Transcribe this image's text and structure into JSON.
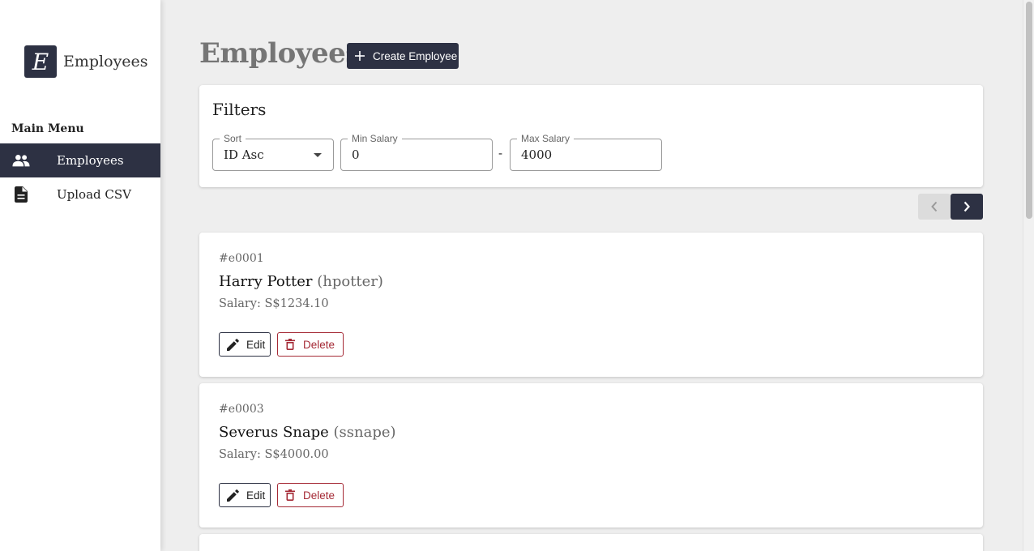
{
  "sidebar": {
    "brand_letter": "E",
    "brand_name": "Employees",
    "menu_heading": "Main Menu",
    "items": [
      {
        "label": "Employees",
        "icon": "people-icon",
        "active": true
      },
      {
        "label": "Upload CSV",
        "icon": "document-icon",
        "active": false
      }
    ]
  },
  "header": {
    "title": "Employees",
    "create_button": "Create Employee"
  },
  "filters": {
    "title": "Filters",
    "sort": {
      "label": "Sort",
      "value": "ID Asc"
    },
    "min_salary": {
      "label": "Min Salary",
      "value": "0"
    },
    "range_separator": "-",
    "max_salary": {
      "label": "Max Salary",
      "value": "4000"
    }
  },
  "employees": [
    {
      "id": "#e0001",
      "name": "Harry Potter",
      "username": "(hpotter)",
      "salary": "Salary: S$1234.10",
      "edit_label": "Edit",
      "delete_label": "Delete"
    },
    {
      "id": "#e0003",
      "name": "Severus Snape",
      "username": "(ssnape)",
      "salary": "Salary: S$4000.00",
      "edit_label": "Edit",
      "delete_label": "Delete"
    }
  ],
  "colors": {
    "primary": "#2d3143",
    "danger": "#a52a36",
    "background": "#eeeeee"
  }
}
